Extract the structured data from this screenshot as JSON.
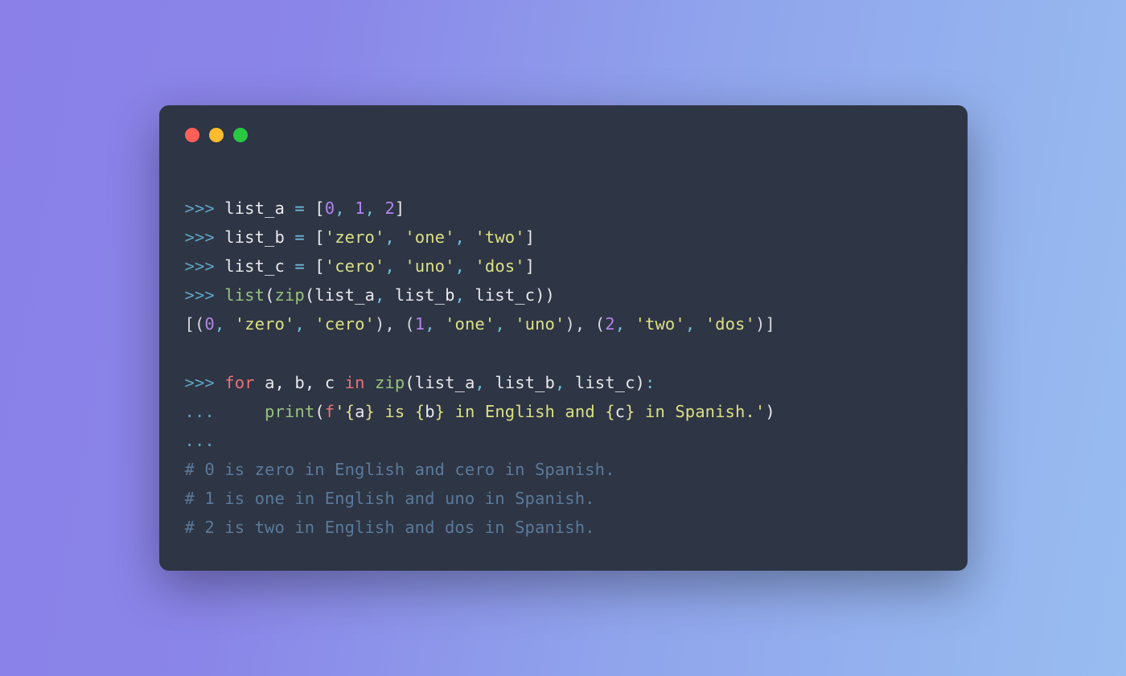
{
  "colors": {
    "bg_terminal": "#2e3544",
    "traffic_red": "#ff5f57",
    "traffic_yellow": "#febc2e",
    "traffic_green": "#28c840"
  },
  "code_lines": {
    "l1": {
      "prompt": ">>>",
      "ident": "list_a",
      "op": "=",
      "lb": "[",
      "v0": "0",
      "c1": ",",
      "v1": "1",
      "c2": ",",
      "v2": "2",
      "rb": "]"
    },
    "l2": {
      "prompt": ">>>",
      "ident": "list_b",
      "op": "=",
      "lb": "[",
      "s0": "'zero'",
      "c1": ",",
      "s1": "'one'",
      "c2": ",",
      "s2": "'two'",
      "rb": "]"
    },
    "l3": {
      "prompt": ">>>",
      "ident": "list_c",
      "op": "=",
      "lb": "[",
      "s0": "'cero'",
      "c1": ",",
      "s1": "'uno'",
      "c2": ",",
      "s2": "'dos'",
      "rb": "]"
    },
    "l4": {
      "prompt": ">>>",
      "fn_list": "list",
      "lp1": "(",
      "fn_zip": "zip",
      "lp2": "(",
      "a1": "list_a",
      "c1": ",",
      "a2": "list_b",
      "c2": ",",
      "a3": "list_c",
      "rp2": ")",
      "rp1": ")"
    },
    "l5": {
      "pre": "[(",
      "n0": "0",
      "c1": ",",
      "s0": "'zero'",
      "c2": ",",
      "s1": "'cero'",
      "mid1": "), (",
      "n1": "1",
      "c3": ",",
      "s2": "'one'",
      "c4": ",",
      "s3": "'uno'",
      "mid2": "), (",
      "n2": "2",
      "c5": ",",
      "s4": "'two'",
      "c6": ",",
      "s5": "'dos'",
      "end": ")]"
    },
    "l6": {
      "blank": ""
    },
    "l7": {
      "prompt": ">>>",
      "kw_for": "for",
      "vars": "a, b, c",
      "kw_in": "in",
      "fn_zip": "zip",
      "lp": "(",
      "a1": "list_a",
      "c1": ",",
      "a2": "list_b",
      "c2": ",",
      "a3": "list_c",
      "rp": ")",
      "colon": ":"
    },
    "l8": {
      "prompt": "...",
      "indent": "     ",
      "fn_print": "print",
      "lp": "(",
      "f_prefix": "f",
      "q_open": "'",
      "lbrace1": "{",
      "var_a": "a",
      "rbrace1": "}",
      "txt1": " is ",
      "lbrace2": "{",
      "var_b": "b",
      "rbrace2": "}",
      "txt2": " in English and ",
      "lbrace3": "{",
      "var_c": "c",
      "rbrace3": "}",
      "txt3": " in Spanish.",
      "q_close": "'",
      "rp": ")"
    },
    "l9": {
      "prompt": "..."
    },
    "l10": {
      "comment": "# 0 is zero in English and cero in Spanish."
    },
    "l11": {
      "comment": "# 1 is one in English and uno in Spanish."
    },
    "l12": {
      "comment": "# 2 is two in English and dos in Spanish."
    }
  }
}
